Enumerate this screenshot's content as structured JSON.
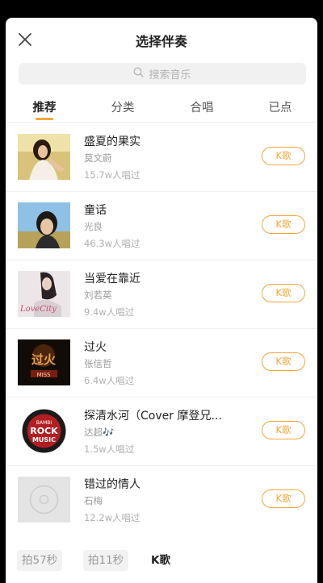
{
  "header": {
    "title": "选择伴奏"
  },
  "search": {
    "placeholder": "搜索音乐"
  },
  "tabs": [
    {
      "label": "推荐",
      "active": true
    },
    {
      "label": "分类",
      "active": false
    },
    {
      "label": "合唱",
      "active": false
    },
    {
      "label": "已点",
      "active": false
    }
  ],
  "songs": [
    {
      "title": "盛夏的果实",
      "artist": "莫文蔚",
      "plays": "15.7w人唱过",
      "button": "K歌"
    },
    {
      "title": "童话",
      "artist": "光良",
      "plays": "46.3w人唱过",
      "button": "K歌"
    },
    {
      "title": "当爱在靠近",
      "artist": "刘若英",
      "plays": "9.4w人唱过",
      "button": "K歌"
    },
    {
      "title": "过火",
      "artist": "张信哲",
      "plays": "6.4w人唱过",
      "button": "K歌"
    },
    {
      "title": "探清水河（Cover 摩登兄...",
      "artist": "达超🎶",
      "plays": "1.5w人唱过",
      "button": "K歌"
    },
    {
      "title": "错过的情人",
      "artist": "石梅",
      "plays": "12.2w人唱过",
      "button": "K歌"
    }
  ],
  "cover_text": {
    "song3": "LoveCity",
    "song4_top": "过火",
    "song4_bottom": "MISS",
    "song5_top": "BAMBI",
    "song5_mid": "ROCK",
    "song5_bottom": "MUSIC"
  },
  "bottom_modes": [
    {
      "label": "拍57秒",
      "active": false
    },
    {
      "label": "拍11秒",
      "active": false
    },
    {
      "label": "K歌",
      "active": true
    }
  ],
  "colors": {
    "accent": "#f5a638",
    "background": "#ffffff"
  }
}
